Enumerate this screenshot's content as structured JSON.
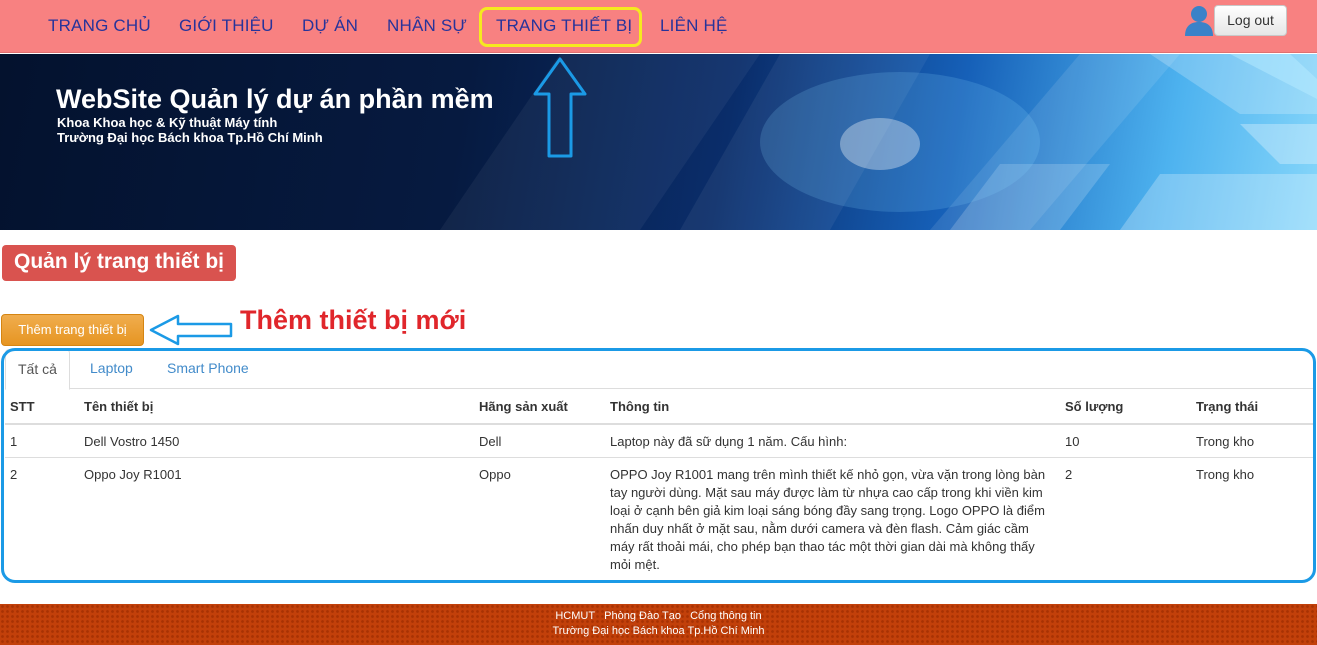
{
  "nav": {
    "items": [
      "TRANG CHỦ",
      "GIỚI THIỆU",
      "DỰ ÁN",
      "NHÂN SỰ",
      "TRANG THIẾT BỊ",
      "LIÊN HỆ"
    ],
    "logout_label": "Log out",
    "user_icon": "user-icon"
  },
  "banner": {
    "title": "WebSite Quản lý dự án phần mềm",
    "line1": "Khoa Khoa học & Kỹ thuật Máy tính",
    "line2": "Trường Đại học Bách khoa Tp.Hồ Chí Minh"
  },
  "page": {
    "title": "Quản lý trang thiết bị",
    "add_button": "Thêm trang thiết bị",
    "annotation": "Thêm thiết bị mới"
  },
  "tabs": [
    "Tất cả",
    "Laptop",
    "Smart Phone"
  ],
  "table": {
    "headers": [
      "STT",
      "Tên thiết bị",
      "Hãng sản xuất",
      "Thông tin",
      "Số lượng",
      "Trạng thái"
    ],
    "rows": [
      [
        "1",
        "Dell Vostro 1450",
        "Dell",
        "Laptop này đã sữ dụng 1 năm. Cấu hình:",
        "10",
        "Trong kho"
      ],
      [
        "2",
        "Oppo Joy R1001",
        "Oppo",
        "OPPO Joy R1001 mang trên mình thiết kế nhỏ gọn, vừa vặn trong lòng bàn tay người dùng. Mặt sau máy được làm từ nhựa cao cấp trong khi viền kim loại ở cạnh bên giả kim loại sáng bóng đầy sang trọng. Logo OPPO là điểm nhấn duy nhất ở mặt sau, nằm dưới camera và đèn flash. Cảm giác cầm máy rất thoải mái, cho phép bạn thao tác một thời gian dài mà không thấy mỏi mệt.",
        "2",
        "Trong kho"
      ]
    ]
  },
  "footer": {
    "links": [
      "HCMUT",
      "Phòng Đào Tạo",
      "Cổng thông tin"
    ],
    "school": "Trường Đại học Bách khoa Tp.Hồ Chí Minh"
  },
  "colors": {
    "navbar": "#f88181",
    "nav_text": "#27339a",
    "highlight": "#f5ea1f",
    "annotation_blue": "#1b9ae6",
    "annotation_red": "#e0262b",
    "title_bg": "#d9534f",
    "add_button": "#f0ad4e",
    "footer": "#c2400a"
  }
}
